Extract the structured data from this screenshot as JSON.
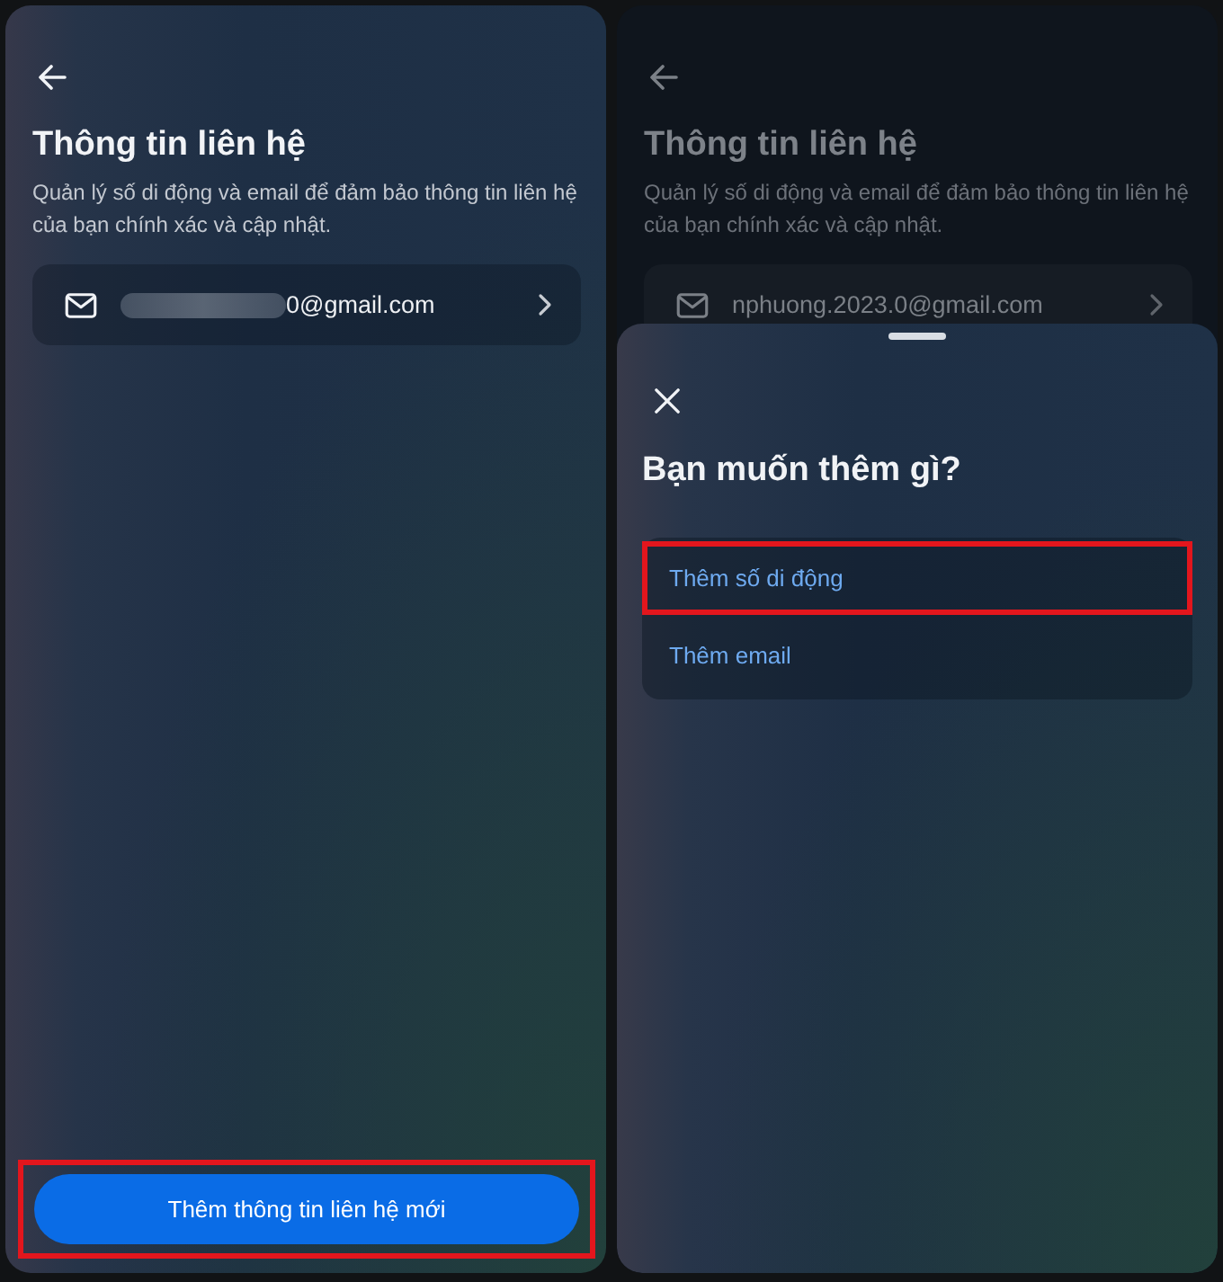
{
  "screens": [
    {
      "dimmed": false,
      "title": "Thông tin liên hệ",
      "description": "Quản lý số di động và email để đảm bảo thông tin liên hệ của bạn chính xác và cập nhật.",
      "contacts": [
        {
          "value": "0@gmail.com",
          "redacted": true
        }
      ],
      "add_button": {
        "label": "Thêm thông tin liên hệ mới",
        "highlighted": true
      }
    },
    {
      "dimmed": true,
      "title": "Thông tin liên hệ",
      "description": "Quản lý số di động và email để đảm bảo thông tin liên hệ của bạn chính xác và cập nhật.",
      "contacts": [
        {
          "value": "nphuong.2023.0@gmail.com",
          "redacted": false
        }
      ],
      "sheet": {
        "title": "Bạn muốn thêm gì?",
        "options": [
          {
            "label": "Thêm số di động",
            "highlighted": true
          },
          {
            "label": "Thêm email",
            "highlighted": false
          }
        ]
      }
    }
  ]
}
